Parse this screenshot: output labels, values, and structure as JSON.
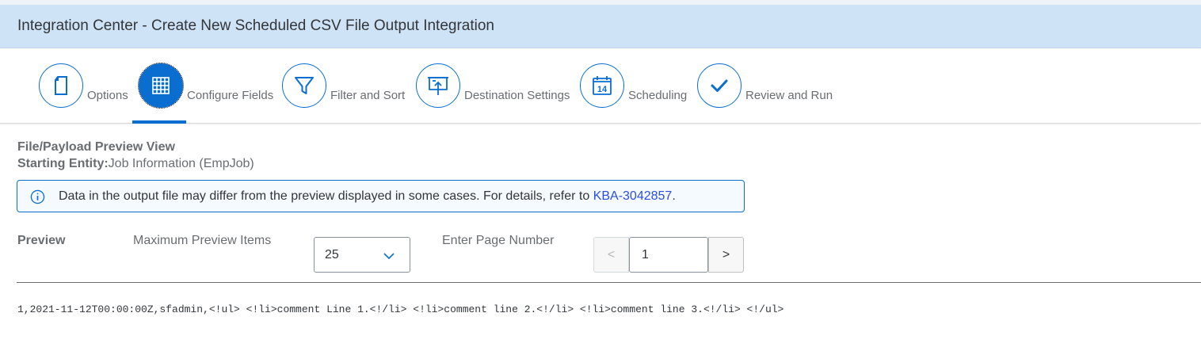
{
  "title": "Integration Center - Create New Scheduled CSV File Output Integration",
  "wizard": {
    "steps": [
      {
        "label": "Options",
        "icon": "document-icon"
      },
      {
        "label": "Configure Fields",
        "icon": "table-icon",
        "active": true
      },
      {
        "label": "Filter and Sort",
        "icon": "filter-icon"
      },
      {
        "label": "Destination Settings",
        "icon": "upload-board-icon"
      },
      {
        "label": "Scheduling",
        "icon": "calendar-icon",
        "calendar_day": "14"
      },
      {
        "label": "Review and Run",
        "icon": "checkmark-icon"
      }
    ]
  },
  "preview_view": {
    "heading": "File/Payload Preview View",
    "entity_label": "Starting Entity:",
    "entity_value": "Job Information (EmpJob)"
  },
  "info_message": {
    "text": "Data in the output file may differ from the preview displayed in some cases. For details, refer to ",
    "link": "KBA-3042857",
    "suffix": "."
  },
  "controls": {
    "preview_label": "Preview",
    "max_items_label": "Maximum Preview Items",
    "max_items_value": "25",
    "page_number_label": "Enter Page Number",
    "page_number_value": "1",
    "prev_label": "<",
    "next_label": ">"
  },
  "payload": "1,2021-11-12T00:00:00Z,sfadmin,<!ul> <!li>comment Line 1.<!/li> <!li>comment line 2.<!/li> <!li>comment line 3.<!/li> <!/ul>",
  "colors": {
    "accent": "#0a6ed1",
    "title_bar": "#cfe3f6",
    "link": "#2c4de2"
  }
}
